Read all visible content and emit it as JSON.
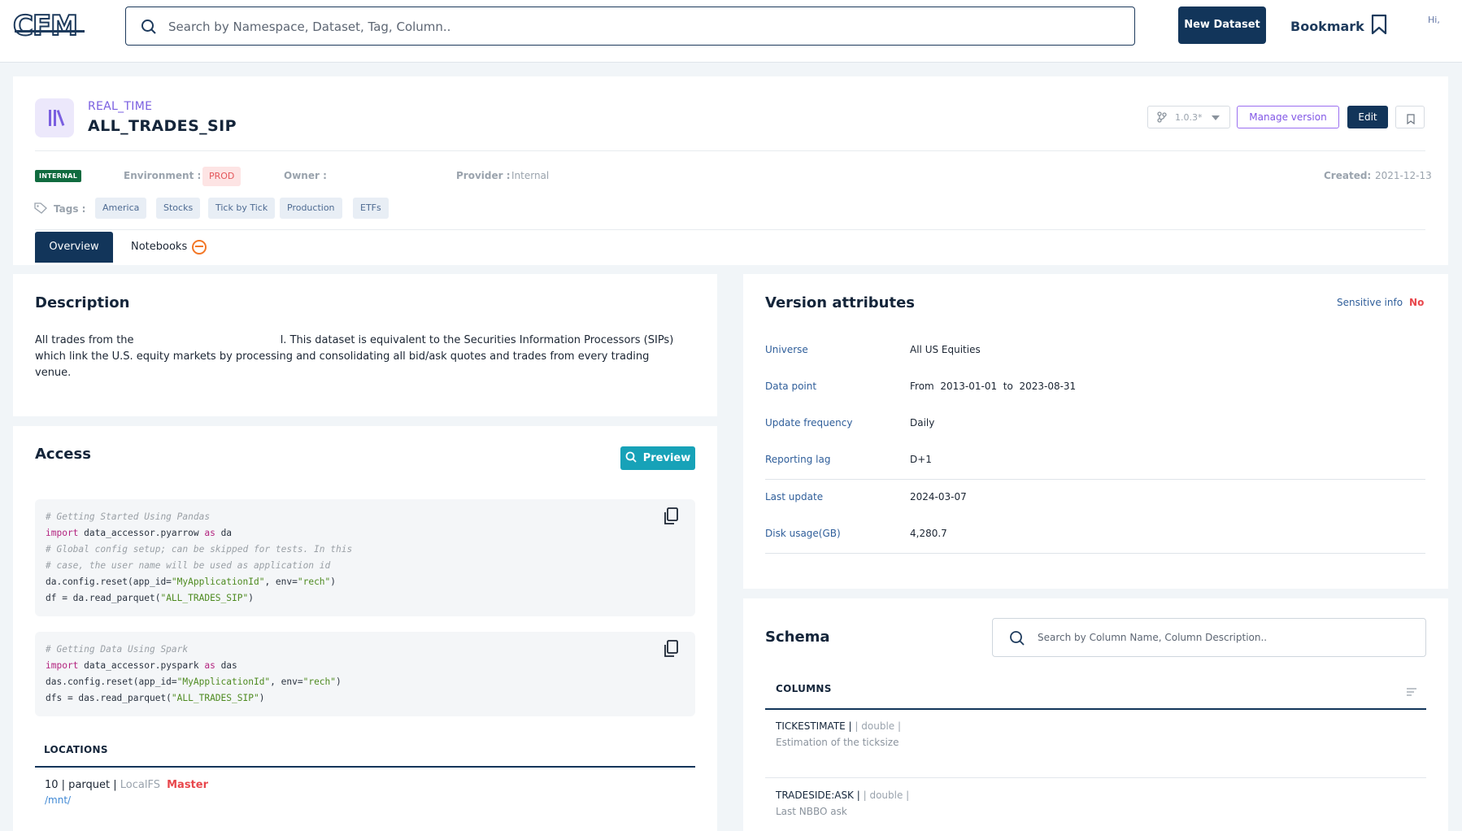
{
  "topbar": {
    "logo_text": "CFM",
    "search_placeholder": "Search by Namespace, Dataset, Tag, Column..",
    "new_dataset_label": "New Dataset",
    "bookmark_label": "Bookmark",
    "greeting": "Hi,"
  },
  "dataset": {
    "namespace": "REAL_TIME",
    "name": "ALL_TRADES_SIP",
    "version": "1.0.3*",
    "manage_version_label": "Manage version",
    "edit_label": "Edit",
    "visibility_badge": "INTERNAL",
    "environment_label": "Environment :",
    "environment_value": "PROD",
    "owner_label": "Owner :",
    "provider_label": "Provider :",
    "provider_value": "Internal",
    "created_label": "Created:",
    "created_value": "2021-12-13",
    "tags_label": "Tags :",
    "tags": [
      "America",
      "Stocks",
      "Tick by Tick",
      "Production",
      "ETFs"
    ]
  },
  "tabs": {
    "overview": "Overview",
    "notebooks": "Notebooks"
  },
  "description": {
    "title": "Description",
    "text_part1": "All trades from the",
    "text_part2": "l. This dataset is equivalent to the Securities Information Processors (SIPs) which link the U.S. equity markets by processing and consolidating all bid/ask quotes and trades from every trading venue."
  },
  "access": {
    "title": "Access",
    "preview_label": "Preview",
    "pandas": {
      "c1": "# Getting Started Using Pandas",
      "import_kw": "import",
      "import_mod": " data_accessor.pyarrow ",
      "as_kw": "as",
      "alias": " da",
      "c2": "# Global config setup; can be skipped for tests. In this",
      "c3": "# case, the user name will be used as application id",
      "reset_pre": "da.config.reset(app_id=",
      "app_id": "\"MyApplicationId\"",
      "env_pre": ", env=",
      "env": "\"rech\"",
      "close": ")",
      "read_pre": "df = da.read_parquet(",
      "ds": "\"ALL_TRADES_SIP\""
    },
    "spark": {
      "c1": "# Getting Data Using Spark",
      "import_kw": "import",
      "import_mod": " data_accessor.pyspark ",
      "as_kw": "as",
      "alias": " das",
      "reset_pre": "das.config.reset(app_id=",
      "app_id": "\"MyApplicationId\"",
      "env_pre": ", env=",
      "env": "\"rech\"",
      "close": ")",
      "read_pre": "dfs = das.read_parquet(",
      "ds": "\"ALL_TRADES_SIP\""
    },
    "locations_title": "LOCATIONS",
    "location": {
      "prefix": "10 | parquet | ",
      "storage": "LocalFS",
      "master": "Master",
      "path": "/mnt/"
    }
  },
  "version_attributes": {
    "title": "Version attributes",
    "sensitive_label": "Sensitive info",
    "sensitive_value": "No",
    "universe_label": "Universe",
    "universe_value": "All US Equities",
    "data_point_label": "Data point",
    "data_point_from": "From",
    "data_point_start": "2013-01-01",
    "data_point_to": "to",
    "data_point_end": "2023-08-31",
    "update_frequency_label": "Update frequency",
    "update_frequency_value": "Daily",
    "reporting_lag_label": "Reporting lag",
    "reporting_lag_value": "D+1",
    "last_update_label": "Last update",
    "last_update_value": "2024-03-07",
    "disk_usage_label": "Disk usage(GB)",
    "disk_usage_value": "4,280.7"
  },
  "schema": {
    "title": "Schema",
    "search_placeholder": "Search by Column Name, Column Description..",
    "columns_title": "COLUMNS",
    "columns": [
      {
        "name": "TICKESTIMATE",
        "sep": " | ",
        "type": "| double |",
        "description": "Estimation of the ticksize"
      },
      {
        "name": "TRADESIDE:ASK",
        "sep": " | ",
        "type": "| double |",
        "description": "Last NBBO ask"
      }
    ]
  },
  "colors": {
    "primary": "#12355a",
    "accent_purple": "#7a5fe0",
    "preview_teal": "#17a2b8",
    "danger": "#e8474c",
    "internal_green": "#106b3f"
  }
}
